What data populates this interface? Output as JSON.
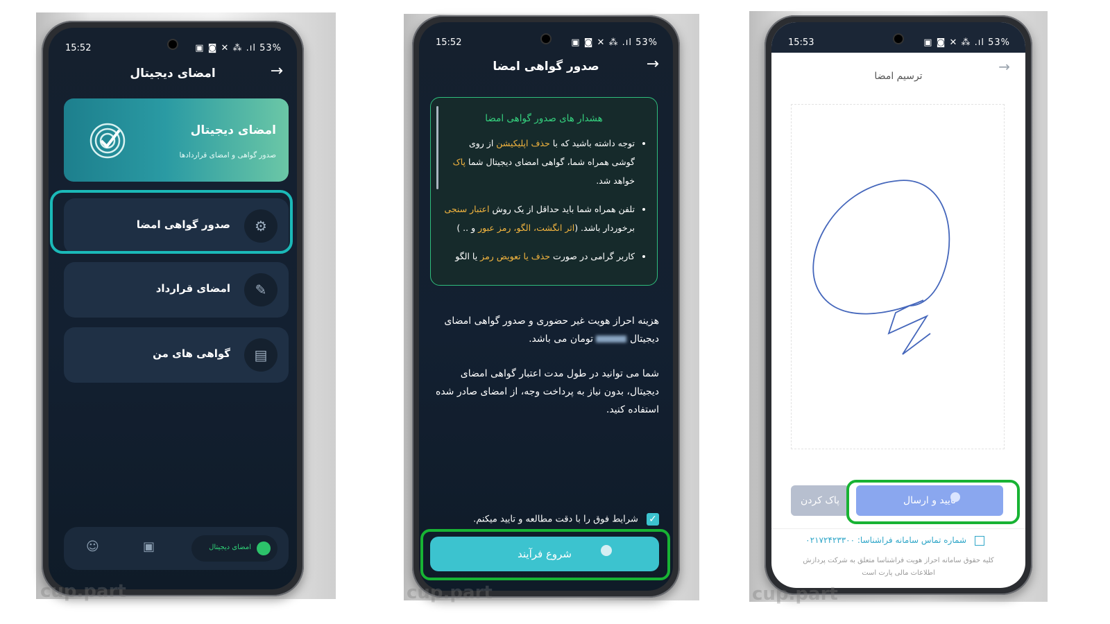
{
  "screen1": {
    "time": "15:52",
    "status_right": "53%",
    "header_title": "امضای دیجیتال",
    "banner_title": "امضای دیجیتال",
    "banner_subtitle": "صدور گواهی و امضای قراردادها",
    "menu": [
      {
        "label": "صدور گواهی امضا",
        "icon": "certificate-icon"
      },
      {
        "label": "امضای قرارداد",
        "icon": "pen-icon"
      },
      {
        "label": "گواهی های من",
        "icon": "clipboard-icon"
      }
    ],
    "bottom_nav_active": "امضای دیجیتال",
    "watermark": "cup.part"
  },
  "screen2": {
    "time": "15:52",
    "status_right": "53%",
    "header_title": "صدور گواهی امضا",
    "warning_title": "هشدار های صدور گواهی امضا",
    "warnings": [
      {
        "a": "توجه داشته باشید که با ",
        "h": "حذف اپلیکیشن",
        "b": " از روی گوشی همراه شما، گواهی امضای دیجیتال شما ",
        "h2": "پاک",
        "c": " خواهد شد."
      },
      {
        "a": "تلفن همراه شما باید حداقل از یک روش ",
        "h": "اعتبار سنجی",
        "b": " برخوردار باشد. (",
        "h2": "اثر انگشت، الگو، رمز عبور",
        "c": " و .. )"
      },
      {
        "a": "کاربر گرامی در صورت ",
        "h": "حذف یا تعویض رمز",
        "b": " یا الگو",
        "h2": "",
        "c": ""
      }
    ],
    "cost_text_1": "هزینه احراز هویت غیر حضوری و صدور گواهی امضای دیجیتال",
    "cost_text_2": "تومان می باشد.",
    "info_text": "شما می توانید در طول مدت اعتبار گواهی امضای دیجیتال، بدون نیاز به پرداخت وجه، از امضای صادر شده استفاده کنید.",
    "agree_label": "شرایط فوق را با دقت مطالعه و تایید میکنم.",
    "start_button": "شروع فرآیند",
    "watermark": "cup.part"
  },
  "screen3": {
    "time": "15:53",
    "status_right": "53%",
    "header_title": "ترسیم امضا",
    "clear_button": "پاک کردن",
    "confirm_button": "تایید و ارسال",
    "contact_text": "شماره تماس سامانه فراشناسا: ۰۲۱۷۲۴۲۳۳۰۰",
    "footer_line_1": "کلیه حقوق سامانه احراز هویت فراشناسا متعلق به شرکت پردازش",
    "footer_line_2": "اطلاعات مالی پارت است",
    "watermark": "cup.part"
  },
  "colors": {
    "accent_teal": "#3cc3cf",
    "highlight_green": "#18b334",
    "warning_yellow": "#f3b53f",
    "signature_blue": "#4466bb"
  }
}
